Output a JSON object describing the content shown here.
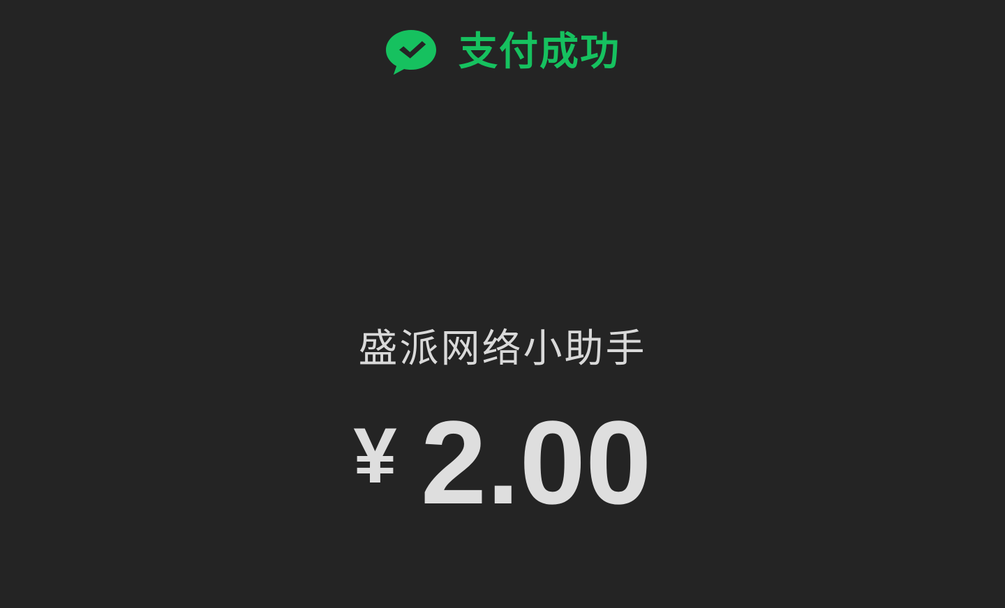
{
  "header": {
    "icon": "wechat-pay-check-icon",
    "status_label": "支付成功"
  },
  "payment": {
    "merchant_name": "盛派网络小助手",
    "currency_symbol": "¥",
    "amount": "2.00"
  },
  "colors": {
    "background": "#242424",
    "accent": "#16c15f",
    "text": "#d8d8d8"
  }
}
